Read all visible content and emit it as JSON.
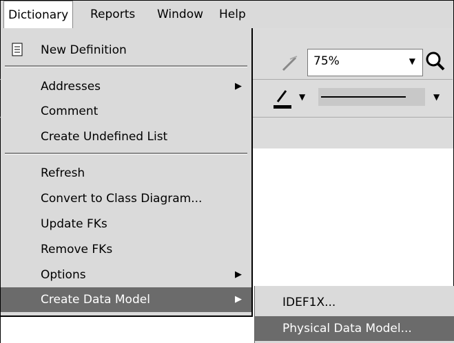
{
  "menubar": {
    "items": [
      "Dictionary",
      "Reports",
      "Window",
      "Help"
    ]
  },
  "toolbar": {
    "zoom_value": "75%"
  },
  "menu": {
    "new_definition": "New Definition",
    "addresses": "Addresses",
    "comment": "Comment",
    "create_undefined_list": "Create Undefined List",
    "refresh": "Refresh",
    "convert_to_class": "Convert to Class Diagram...",
    "update_fks": "Update FKs",
    "remove_fks": "Remove FKs",
    "options": "Options",
    "create_data_model": "Create Data Model"
  },
  "submenu": {
    "idef1x": "IDEF1X...",
    "physical": "Physical Data Model..."
  }
}
